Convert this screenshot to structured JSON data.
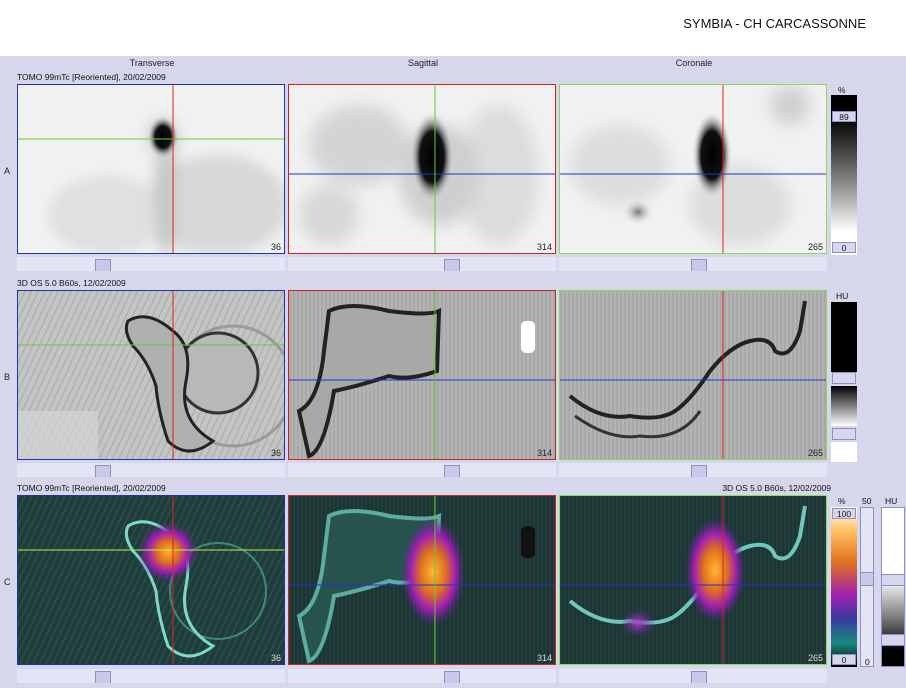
{
  "header": {
    "brand": "SYMBIA - CH CARCASSONNE"
  },
  "columns": [
    {
      "title": "Transverse"
    },
    {
      "title": "Sagittal"
    },
    {
      "title": "Coronale"
    }
  ],
  "rows": [
    {
      "letter": "A",
      "info_left": "TOMO 99mTc [Reoriented], 20/02/2009",
      "info_right": ""
    },
    {
      "letter": "B",
      "info_left": "3D  OS  5.0  B60s, 12/02/2009",
      "info_right": ""
    },
    {
      "letter": "C",
      "info_left": "TOMO 99mTc [Reoriented], 20/02/2009",
      "info_right": "3D  OS  5.0  B60s, 12/02/2009"
    }
  ],
  "slice_numbers": [
    "36",
    "314",
    "265"
  ],
  "scales": {
    "a": {
      "unit": "%",
      "max": "89",
      "min": "0"
    },
    "b": {
      "unit": "HU"
    },
    "c": {
      "unit": "%",
      "max": "100",
      "min": "0",
      "mid": "50",
      "unit2": "HU",
      "min2": "0"
    }
  },
  "colors": {
    "background": "#d6d7ec",
    "transverse_border": "#2233aa",
    "sagittal_border": "#cc2222",
    "coronal_border": "#88dd55",
    "crosshair_red": "#dd2222",
    "crosshair_green": "#66cc33",
    "crosshair_blue": "#2233cc"
  }
}
